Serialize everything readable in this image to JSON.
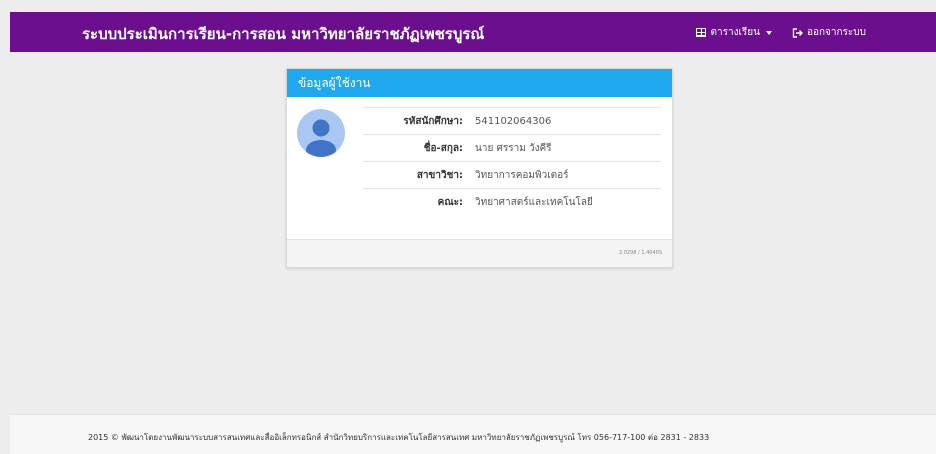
{
  "navbar": {
    "title": "ระบบประเมินการเรียน-การสอน มหาวิทยาลัยราชภัฏเพชรบูรณ์",
    "schedule_label": "ตารางเรียน",
    "logout_label": "ออกจากระบบ"
  },
  "card": {
    "header": "ข้อมูลผู้ใช้งาน",
    "rows": [
      {
        "label": "รหัสนักศึกษา:",
        "value": "541102064306"
      },
      {
        "label": "ชื่อ-สกุล:",
        "value": "นาย ศรราม วังคีรี"
      },
      {
        "label": "สาขาวิชา:",
        "value": "วิทยาการคอมพิวเตอร์"
      },
      {
        "label": "คณะ:",
        "value": "วิทยาศาสตร์และเทคโนโลยี"
      }
    ],
    "timing": "2.0298 / 1.4040S"
  },
  "footer": {
    "text": "2015 © พัฒนาโดยงานพัฒนาระบบสารสนเทศและสื่ออิเล็กทรอนิกส์ สำนักวิทยบริการและเทคโนโลยีสารสนเทศ มหาวิทยาลัยราชภัฏเพชรบูรณ์ โทร 056-717-100 ต่อ 2831 - 2833"
  },
  "colors": {
    "navbar": "#6b0f8e",
    "card_header": "#1fa8ed",
    "avatar_bg": "#a9c7f1",
    "avatar_fg": "#3f74c9"
  },
  "icons": {
    "schedule": "table-icon",
    "dropdown": "caret-down-icon",
    "logout": "logout-icon",
    "avatar": "user-avatar-icon"
  }
}
